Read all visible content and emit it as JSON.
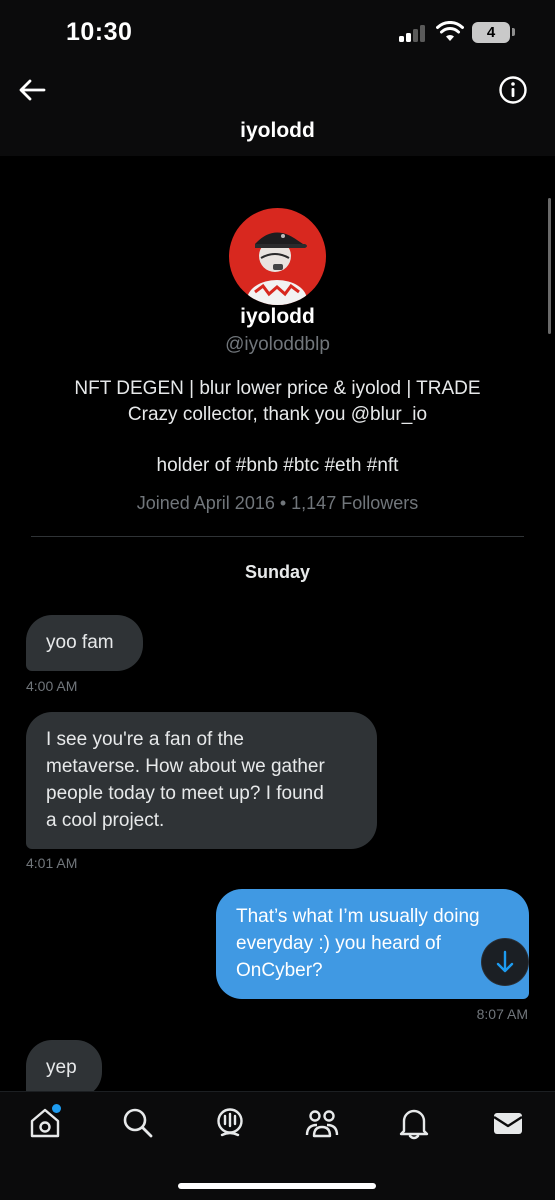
{
  "status_bar": {
    "time": "10:30",
    "battery": "4"
  },
  "header": {
    "title": "iyolodd",
    "back_icon": "arrow-left-icon",
    "info_icon": "info-circle-icon"
  },
  "profile": {
    "name": "iyolodd",
    "handle": "@iyoloddblp",
    "bio_line1": "NFT DEGEN | blur lower price & iyolod | TRADE",
    "bio_line2": "Crazy collector, thank you @blur_io",
    "bio_line3": "holder of #bnb #btc #eth #nft",
    "joined": "Joined April 2016 • 1,147 Followers"
  },
  "conversation": {
    "day": "Sunday",
    "messages": [
      {
        "direction": "in",
        "lines": [
          "yoo fam"
        ],
        "time": "4:00 AM"
      },
      {
        "direction": "in",
        "lines": [
          "I see you're a fan of the",
          "metaverse. How about we gather",
          "people today to meet up? I found",
          "a cool project."
        ],
        "time": "4:01 AM"
      },
      {
        "direction": "out",
        "lines": [
          "That’s what I’m usually doing",
          "everyday :) you heard of",
          "OnCyber?"
        ],
        "time": "8:07 AM"
      },
      {
        "direction": "in",
        "lines": [
          "yep"
        ],
        "time": ""
      }
    ]
  },
  "tab_bar": {
    "items": [
      {
        "name": "home",
        "icon": "home-icon"
      },
      {
        "name": "search",
        "icon": "search-icon"
      },
      {
        "name": "spaces",
        "icon": "spaces-icon"
      },
      {
        "name": "communities",
        "icon": "communities-icon"
      },
      {
        "name": "notifications",
        "icon": "bell-icon"
      },
      {
        "name": "messages",
        "icon": "envelope-icon"
      }
    ]
  },
  "colors": {
    "accent": "#1d9bf0",
    "outgoing_bubble": "#4099e3",
    "incoming_bubble": "#2f3336",
    "muted_text": "#71767b"
  }
}
